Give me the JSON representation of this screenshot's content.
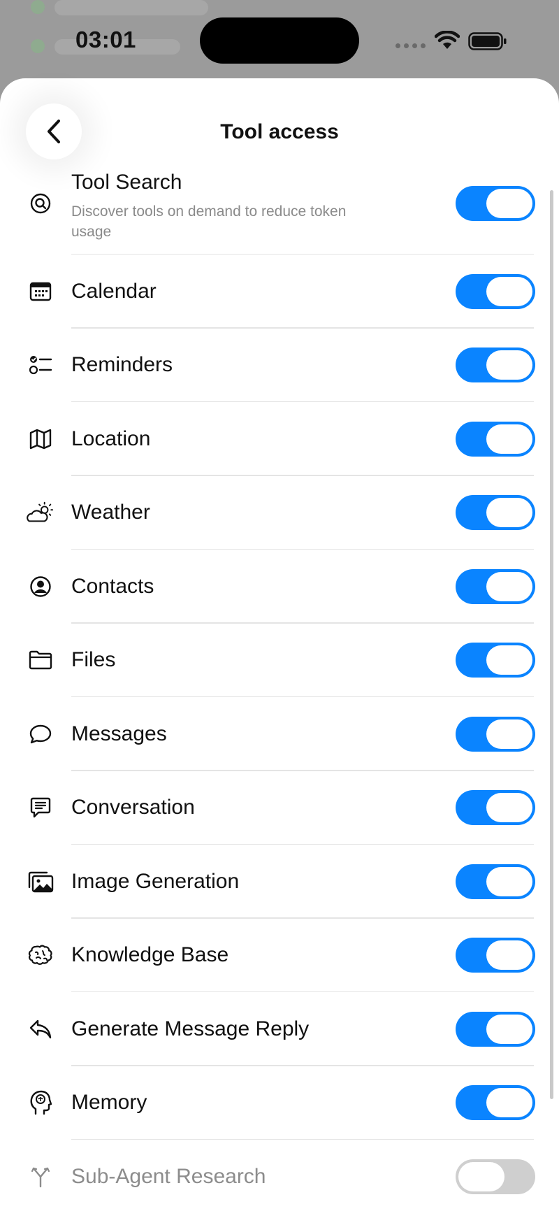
{
  "status": {
    "time": "03:01"
  },
  "header": {
    "title": "Tool access"
  },
  "colors": {
    "accent": "#0a84ff",
    "toggle_off": "#cfcfcf"
  },
  "tools": [
    {
      "label": "Tool Search",
      "subtitle": "Discover tools on demand to reduce token usage",
      "icon": "search-icon",
      "enabled": true
    },
    {
      "label": "Calendar",
      "icon": "calendar-icon",
      "enabled": true
    },
    {
      "label": "Reminders",
      "icon": "checklist-icon",
      "enabled": true
    },
    {
      "label": "Location",
      "icon": "map-icon",
      "enabled": true
    },
    {
      "label": "Weather",
      "icon": "cloud-sun-icon",
      "enabled": true
    },
    {
      "label": "Contacts",
      "icon": "person-circle-icon",
      "enabled": true
    },
    {
      "label": "Files",
      "icon": "folder-icon",
      "enabled": true
    },
    {
      "label": "Messages",
      "icon": "chat-bubble-icon",
      "enabled": true
    },
    {
      "label": "Conversation",
      "icon": "message-text-icon",
      "enabled": true
    },
    {
      "label": "Image Generation",
      "icon": "photos-icon",
      "enabled": true
    },
    {
      "label": "Knowledge Base",
      "icon": "brain-icon",
      "enabled": true
    },
    {
      "label": "Generate Message Reply",
      "icon": "reply-icon",
      "enabled": true
    },
    {
      "label": "Memory",
      "icon": "head-brain-icon",
      "enabled": true
    },
    {
      "label": "Sub-Agent Research",
      "icon": "branch-icon",
      "enabled": false
    }
  ]
}
